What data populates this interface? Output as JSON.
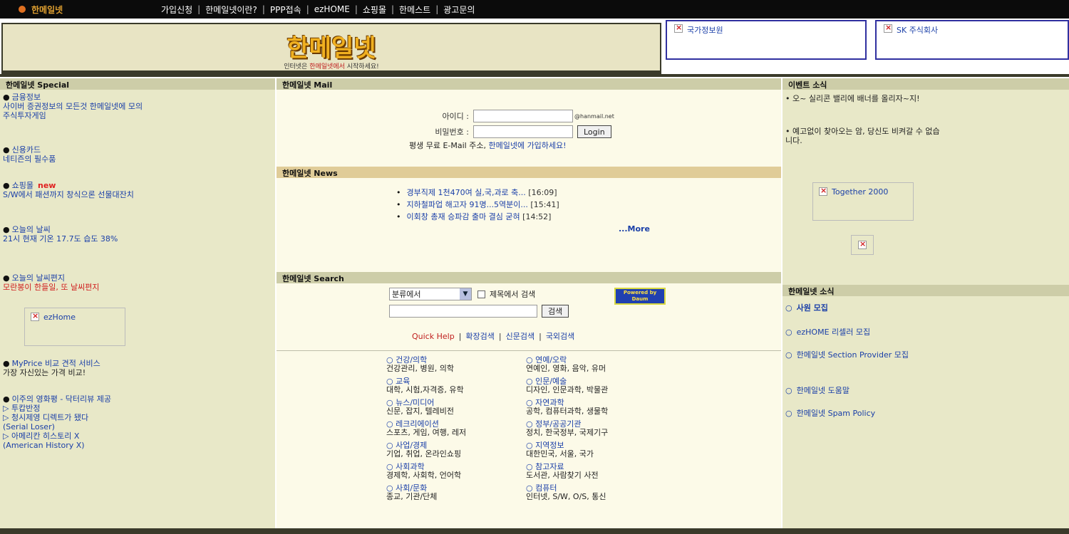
{
  "topbar": {
    "brand": "한메일넷",
    "links": [
      "가입신청",
      "한메일넷이란?",
      "PPP접속",
      "ezHOME",
      "쇼핑몰",
      "한메스트",
      "광고문의"
    ]
  },
  "header": {
    "logo": "한메일넷",
    "tagline_pre": "인터넷은 ",
    "tagline_hl": "한메일넷에서",
    "tagline_post": " 시작하세요!",
    "banner1": "국가정보원",
    "banner2": "SK 주식회사"
  },
  "left": {
    "title": "한메일넷 Special",
    "items": [
      {
        "title": "금융정보",
        "desc": "사이버 증권정보의 모든것 한메일넷에 모의 주식투자게임"
      },
      {
        "title": "신용카드",
        "desc": "네티즌의 필수품"
      },
      {
        "title": "쇼핑몰",
        "new": "new",
        "desc": "S/W에서 패션까지 창식으론 선물대잔치"
      },
      {
        "title": "오늘의 날씨",
        "desc": "21시 현재 기온 17.7도 습도 38%"
      },
      {
        "title": "오늘의 날씨편지",
        "desc": "모란봉이 한들일, 또 날씨편지"
      }
    ],
    "ezhome": "ezHome",
    "myprice_title": "MyPrice 비교 견적 서비스",
    "myprice_desc": "가장 자신있는 가격 비교!",
    "movie_title": "이주의 영화평 - 닥터리뷰 제공",
    "movie_lines": [
      "▷ 투캅반정",
      "▷ 청시제영 디렉트가 됐다",
      "(Serial Loser)",
      "▷ 아메리칸 히스토리 X",
      "(American History X)"
    ]
  },
  "mail": {
    "title": "한메일넷 Mail",
    "id_label": "아이디 :",
    "domain": "@hanmail.net",
    "pw_label": "비밀번호 :",
    "login": "Login",
    "promo_pre": "평생 무료 E-Mail 주소, ",
    "promo_link": "한메일넷에 가입하세요!"
  },
  "news": {
    "title": "한메일넷 News",
    "items": [
      {
        "text": "경부직제 1천470여 실,국,과로 축...",
        "time": "[16:09]"
      },
      {
        "text": "지하철파업 해고자 91명...5역분이...",
        "time": "[15:41]"
      },
      {
        "text": "이회창 총재 승파감 출마 결심 굳혀",
        "time": "[14:52]"
      }
    ],
    "more": "...More"
  },
  "search": {
    "title": "한메일넷 Search",
    "select": "분류에서",
    "checkbox_label": "제목에서 검색",
    "button": "검색",
    "powered_1": "Powered by",
    "powered_2": "Daum",
    "quick_help": "Quick Help",
    "ext": [
      "확장검색",
      "신문검색",
      "국외검색"
    ]
  },
  "directory": {
    "left": [
      {
        "cat": "건강/의학",
        "sub": "건강관리, 병원, 의학"
      },
      {
        "cat": "교육",
        "sub": "대학, 시험,자격증, 유학"
      },
      {
        "cat": "뉴스/미디어",
        "sub": "신문, 잡지, 텔레비전"
      },
      {
        "cat": "레크리에이션",
        "sub": "스포츠, 게임, 여행, 레저"
      },
      {
        "cat": "사업/경제",
        "sub": "기업, 취업, 온라인쇼핑"
      },
      {
        "cat": "사회과학",
        "sub": "경제학, 사회학, 언어학"
      },
      {
        "cat": "사회/문화",
        "sub": "종교, 기관/단체"
      }
    ],
    "right": [
      {
        "cat": "연예/오락",
        "sub": "연예인, 영화, 음악, 유머"
      },
      {
        "cat": "인문/예술",
        "sub": "디자인, 인문과학, 박물관"
      },
      {
        "cat": "자연과학",
        "sub": "공학, 컴퓨터과학, 생물학"
      },
      {
        "cat": "정부/공공기관",
        "sub": "정치, 한국정부, 국제기구"
      },
      {
        "cat": "지역정보",
        "sub": "대한민국, 서울, 국가"
      },
      {
        "cat": "참고자료",
        "sub": "도서관, 사람찾기 사전"
      },
      {
        "cat": "컴퓨터",
        "sub": "인터넷, S/W, O/S, 통신"
      }
    ]
  },
  "right": {
    "event_title": "이벤트 소식",
    "event1": "오~ 실리콘 밸리에 배너를 올리자~지!",
    "event2": "예고없이 찾아오는 암, 당신도 비켜갈 수 없습니다.",
    "together": "Together 2000",
    "news_title": "한메일넷 소식",
    "links": [
      "사원 모집",
      "ezHOME 리셀러 모집",
      "한메일넷 Section Provider 모집",
      "한메일넷 도움말",
      "한메일넷 Spam Policy"
    ]
  }
}
